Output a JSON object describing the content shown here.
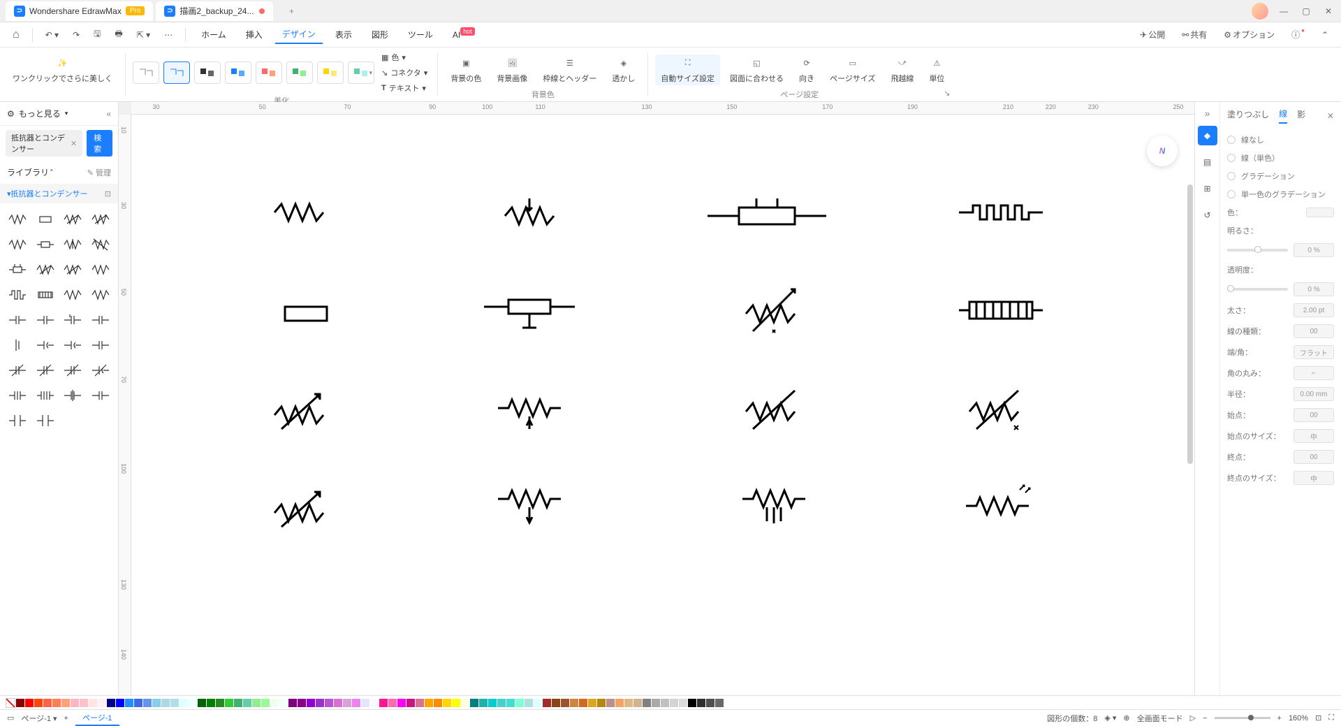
{
  "titlebar": {
    "app_name": "Wondershare EdrawMax",
    "pro_badge": "Pro",
    "doc_name": "描画2_backup_24...",
    "add": "+"
  },
  "toolbar": {
    "home_icon": "⌂",
    "menus": [
      "ホーム",
      "挿入",
      "デザイン",
      "表示",
      "図形",
      "ツール",
      "AI"
    ],
    "active_menu": 2,
    "hot": "hot",
    "right": {
      "publish": "公開",
      "share": "共有",
      "options": "オプション"
    }
  },
  "ribbon": {
    "one_click": "ワンクリックでさらに美しく",
    "group_beautify": "美化",
    "color": "色",
    "connector": "コネクタ",
    "text": "テキスト",
    "bg_color": "背景の色",
    "bg_image": "背景画像",
    "frame_header": "枠線とヘッダー",
    "watermark": "透かし",
    "group_bg": "背景色",
    "auto_size": "自動サイズ設定",
    "fit_drawing": "図面に合わせる",
    "orientation": "向き",
    "page_size": "ページサイズ",
    "jump_line": "飛越線",
    "unit": "単位",
    "group_page": "ページ設定"
  },
  "left": {
    "more": "もっと見る",
    "search_chip": "抵抗器とコンデンサー",
    "search_btn": "検索",
    "library": "ライブラリ",
    "manage": "管理",
    "category": "抵抗器とコンデンサー"
  },
  "ruler_h": [
    "30",
    "50",
    "70",
    "90",
    "100",
    "110",
    "130",
    "150",
    "170",
    "190",
    "210",
    "220",
    "230",
    "250"
  ],
  "ruler_v": [
    "10",
    "30",
    "50",
    "70",
    "100",
    "130",
    "140"
  ],
  "right": {
    "tabs": [
      "塗りつぶし",
      "線",
      "影"
    ],
    "active_tab": 1,
    "none": "線なし",
    "solid": "線（単色）",
    "gradient": "グラデーション",
    "single_grad": "単一色のグラデーション",
    "color_lbl": "色：",
    "brightness": "明るさ：",
    "brightness_val": "0 %",
    "opacity": "透明度：",
    "opacity_val": "0 %",
    "thickness": "太さ：",
    "thickness_val": "2.00 pt",
    "line_type": "線の種類：",
    "line_type_val": "00",
    "cap": "端/角：",
    "cap_val": "フラット",
    "corner": "角の丸み：",
    "radius": "半径：",
    "radius_val": "0.00 mm",
    "start": "始点：",
    "start_val": "00",
    "start_size": "始点のサイズ：",
    "start_size_val": "中",
    "end": "終点：",
    "end_val": "00",
    "end_size": "終点のサイズ：",
    "end_size_val": "中"
  },
  "status": {
    "page_dropdown": "ページ-1",
    "page_tab": "ページ-1",
    "shape_count_lbl": "図形の個数：",
    "shape_count": "8",
    "fullscreen": "全画面モード",
    "zoom": "160%"
  },
  "colors": [
    "#8b0000",
    "#ff0000",
    "#ff4500",
    "#ff6347",
    "#ff7f50",
    "#ffa07a",
    "#ffb6c1",
    "#ffc0cb",
    "#ffe4e1",
    "#fff0f5",
    "#00008b",
    "#0000ff",
    "#1e90ff",
    "#4169e1",
    "#6495ed",
    "#87ceeb",
    "#add8e6",
    "#b0e0e6",
    "#e0ffff",
    "#f0ffff",
    "#006400",
    "#008000",
    "#228b22",
    "#32cd32",
    "#3cb371",
    "#66cdaa",
    "#90ee90",
    "#98fb98",
    "#f0fff0",
    "#f5fffa",
    "#800080",
    "#8b008b",
    "#9400d3",
    "#9932cc",
    "#ba55d3",
    "#da70d6",
    "#dda0dd",
    "#ee82ee",
    "#e6e6fa",
    "#f8f8ff",
    "#ff1493",
    "#ff69b4",
    "#ff00ff",
    "#c71585",
    "#db7093",
    "#ffa500",
    "#ff8c00",
    "#ffd700",
    "#ffff00",
    "#ffffe0",
    "#008080",
    "#20b2aa",
    "#00ced1",
    "#48d1cc",
    "#40e0d0",
    "#7fffd4",
    "#afe0e0",
    "#e0ffff",
    "#a52a2a",
    "#8b4513",
    "#a0522d",
    "#cd853f",
    "#d2691e",
    "#daa520",
    "#b8860b",
    "#bc8f8f",
    "#f4a460",
    "#deb887",
    "#d2b48c",
    "#808080",
    "#a9a9a9",
    "#c0c0c0",
    "#d3d3d3",
    "#dcdcdc",
    "#000000",
    "#2f2f2f",
    "#4f4f4f",
    "#696969",
    "#ffffff"
  ]
}
